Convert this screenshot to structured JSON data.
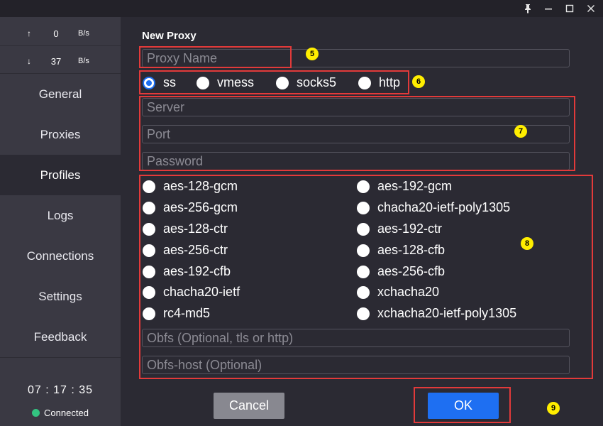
{
  "titlebar": {
    "pin_icon": "📌",
    "minimize": "—",
    "maximize": "☐",
    "close": "✕"
  },
  "speed": {
    "up": {
      "arrow": "↑",
      "value": "0",
      "unit": "B/s"
    },
    "down": {
      "arrow": "↓",
      "value": "37",
      "unit": "B/s"
    }
  },
  "nav": {
    "general": "General",
    "proxies": "Proxies",
    "profiles": "Profiles",
    "logs": "Logs",
    "connections": "Connections",
    "settings": "Settings",
    "feedback": "Feedback"
  },
  "footer": {
    "time": "07 : 17 : 35",
    "status": "Connected",
    "status_color": "#33c481"
  },
  "form": {
    "title": "New Proxy",
    "proxy_name_placeholder": "Proxy Name",
    "types": {
      "ss": "ss",
      "vmess": "vmess",
      "socks5": "socks5",
      "http": "http"
    },
    "selected_type": "ss",
    "server_placeholder": "Server",
    "port_placeholder": "Port",
    "password_placeholder": "Password",
    "ciphers": {
      "aes_128_gcm": "aes-128-gcm",
      "aes_192_gcm": "aes-192-gcm",
      "aes_256_gcm": "aes-256-gcm",
      "chacha20_ietf_poly1305": "chacha20-ietf-poly1305",
      "aes_128_ctr": "aes-128-ctr",
      "aes_192_ctr": "aes-192-ctr",
      "aes_256_ctr": "aes-256-ctr",
      "aes_128_cfb": "aes-128-cfb",
      "aes_192_cfb": "aes-192-cfb",
      "aes_256_cfb": "aes-256-cfb",
      "chacha20_ietf": "chacha20-ietf",
      "xchacha20": "xchacha20",
      "rc4_md5": "rc4-md5",
      "xchacha20_ietf_poly1305": "xchacha20-ietf-poly1305"
    },
    "obfs_placeholder": "Obfs (Optional, tls or http)",
    "obfs_host_placeholder": "Obfs-host (Optional)",
    "cancel_label": "Cancel",
    "ok_label": "OK"
  },
  "annotations": {
    "n5": "5",
    "n6": "6",
    "n7": "7",
    "n8": "8",
    "n9": "9",
    "color": "#e23a3a",
    "badge_color": "#ffee00"
  },
  "colors": {
    "accent": "#1e6ff2",
    "background": "#2b2a33",
    "sidebar": "#3a3943"
  }
}
